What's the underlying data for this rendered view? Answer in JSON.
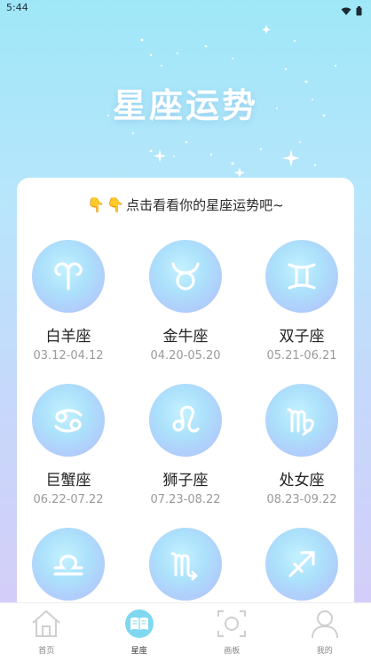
{
  "status": {
    "time": "5:44"
  },
  "header": {
    "title": "星座运势"
  },
  "prompt": {
    "text": "点击看看你的星座运势吧~"
  },
  "signs": [
    {
      "name": "白羊座",
      "dates": "03.12-04.12",
      "icon": "aries-icon"
    },
    {
      "name": "金牛座",
      "dates": "04.20-05.20",
      "icon": "taurus-icon"
    },
    {
      "name": "双子座",
      "dates": "05.21-06.21",
      "icon": "gemini-icon"
    },
    {
      "name": "巨蟹座",
      "dates": "06.22-07.22",
      "icon": "cancer-icon"
    },
    {
      "name": "狮子座",
      "dates": "07.23-08.22",
      "icon": "leo-icon"
    },
    {
      "name": "处女座",
      "dates": "08.23-09.22",
      "icon": "virgo-icon"
    },
    {
      "name": "",
      "dates": "",
      "icon": "libra-icon"
    },
    {
      "name": "",
      "dates": "",
      "icon": "scorpio-icon"
    },
    {
      "name": "",
      "dates": "",
      "icon": "sagittarius-icon"
    }
  ],
  "tabs": [
    {
      "label": "首页",
      "icon": "home-icon"
    },
    {
      "label": "星座",
      "icon": "book-icon",
      "active": true
    },
    {
      "label": "画板",
      "icon": "camera-icon"
    },
    {
      "label": "我的",
      "icon": "profile-icon"
    }
  ],
  "colors": {
    "accent": "#6fd3ee",
    "card": "#ffffff"
  }
}
